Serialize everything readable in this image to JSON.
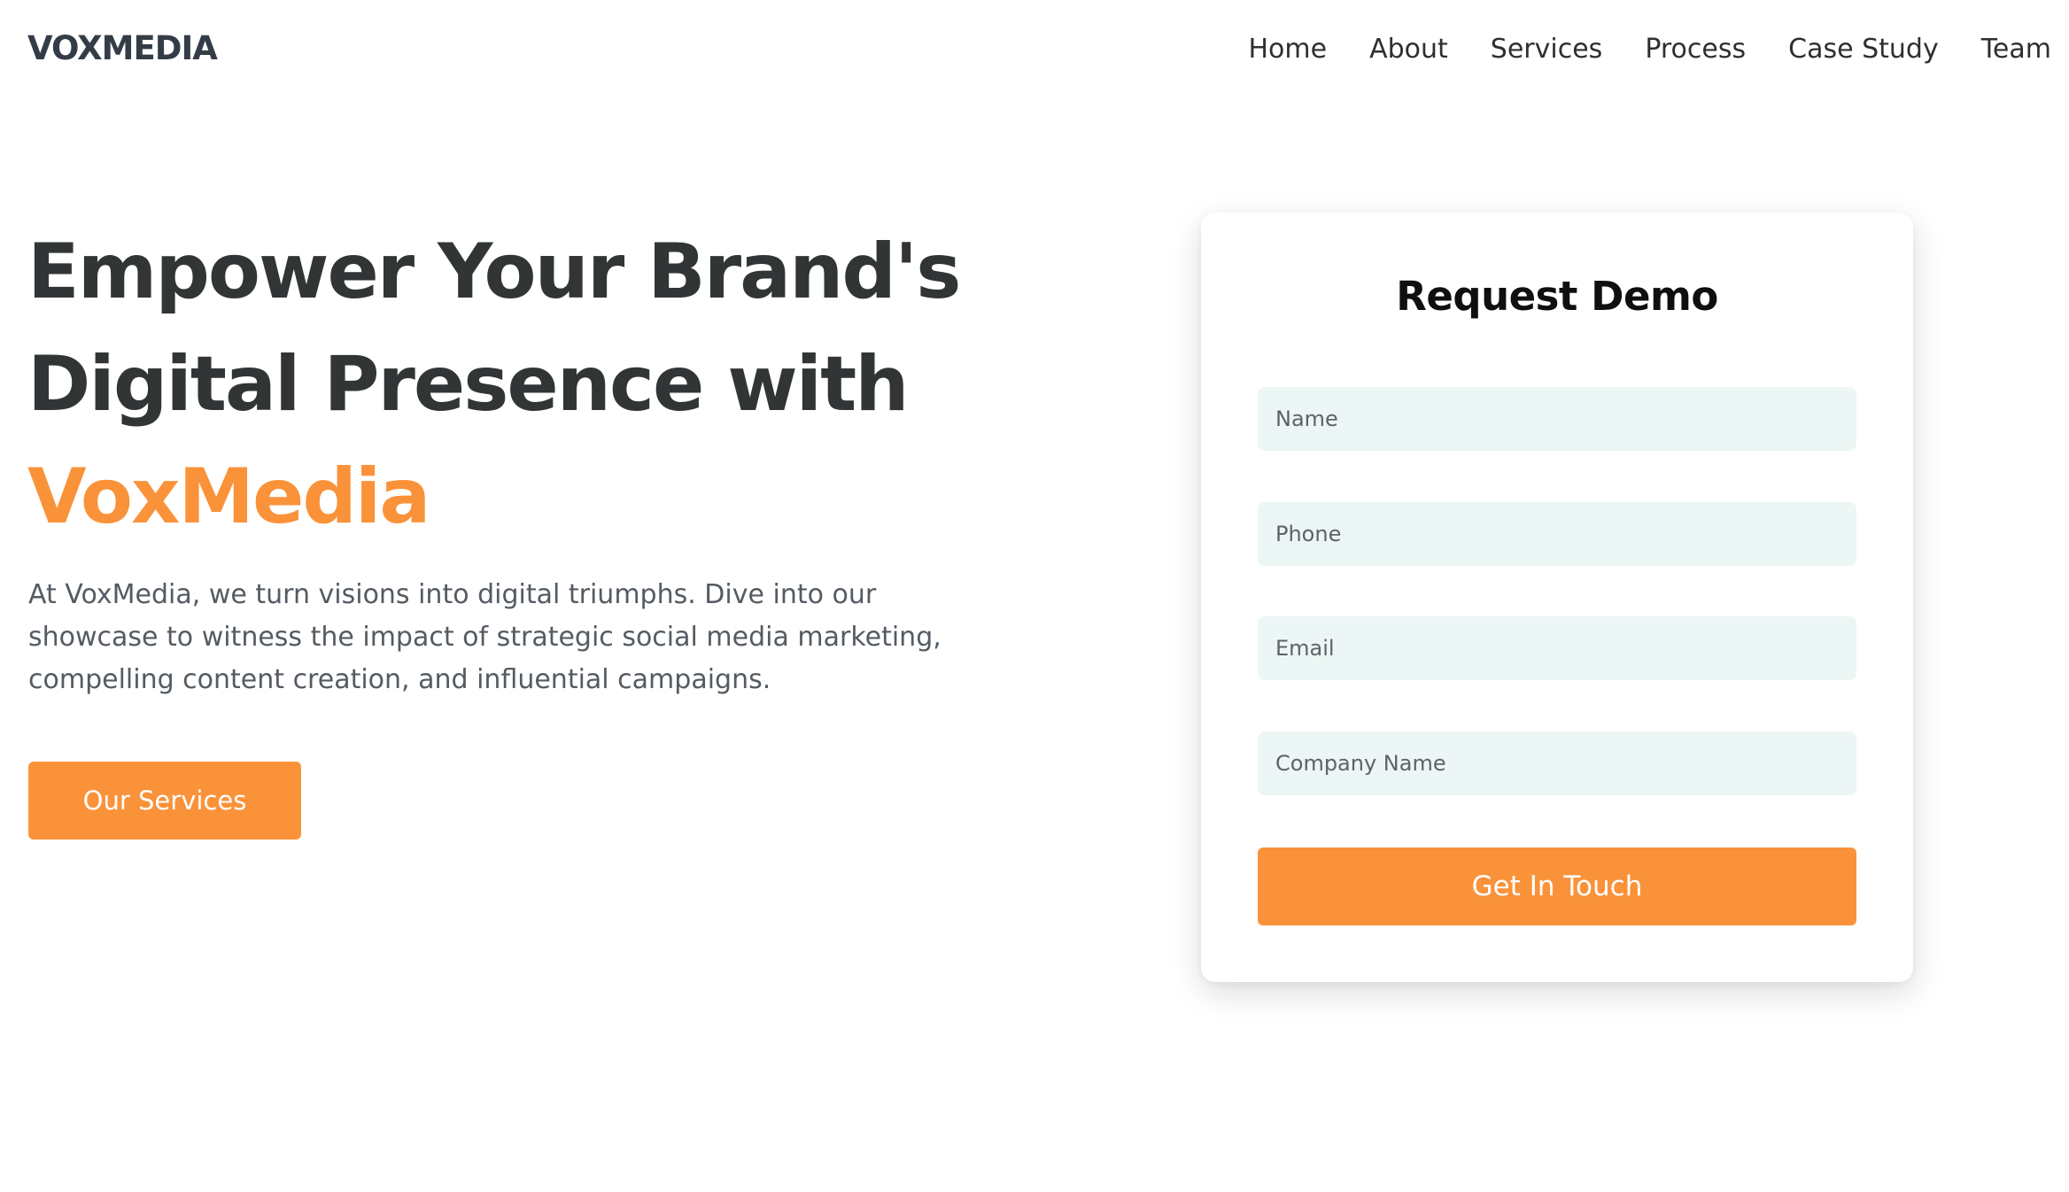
{
  "brand": {
    "logo_text": "VOXMEDIA"
  },
  "nav": {
    "items": [
      {
        "label": "Home"
      },
      {
        "label": "About"
      },
      {
        "label": "Services"
      },
      {
        "label": "Process"
      },
      {
        "label": "Case Study"
      },
      {
        "label": "Team"
      }
    ]
  },
  "hero": {
    "title_line1": "Empower Your Brand's",
    "title_line2": "Digital Presence with",
    "title_brand": "VoxMedia",
    "description": "At VoxMedia, we turn visions into digital triumphs. Dive into our showcase to witness the impact of strategic social media marketing, compelling content creation, and influential campaigns.",
    "cta_label": "Our Services"
  },
  "form": {
    "title": "Request Demo",
    "name_placeholder": "Name",
    "name_value": "",
    "phone_placeholder": "Phone",
    "phone_value": "",
    "email_placeholder": "Email",
    "email_value": "",
    "company_placeholder": "Company Name",
    "company_value": "",
    "submit_label": "Get In Touch"
  },
  "colors": {
    "accent": "#fa923a",
    "heading": "#323536",
    "body_text": "#545b62",
    "field_background": "#ecf6f4"
  }
}
